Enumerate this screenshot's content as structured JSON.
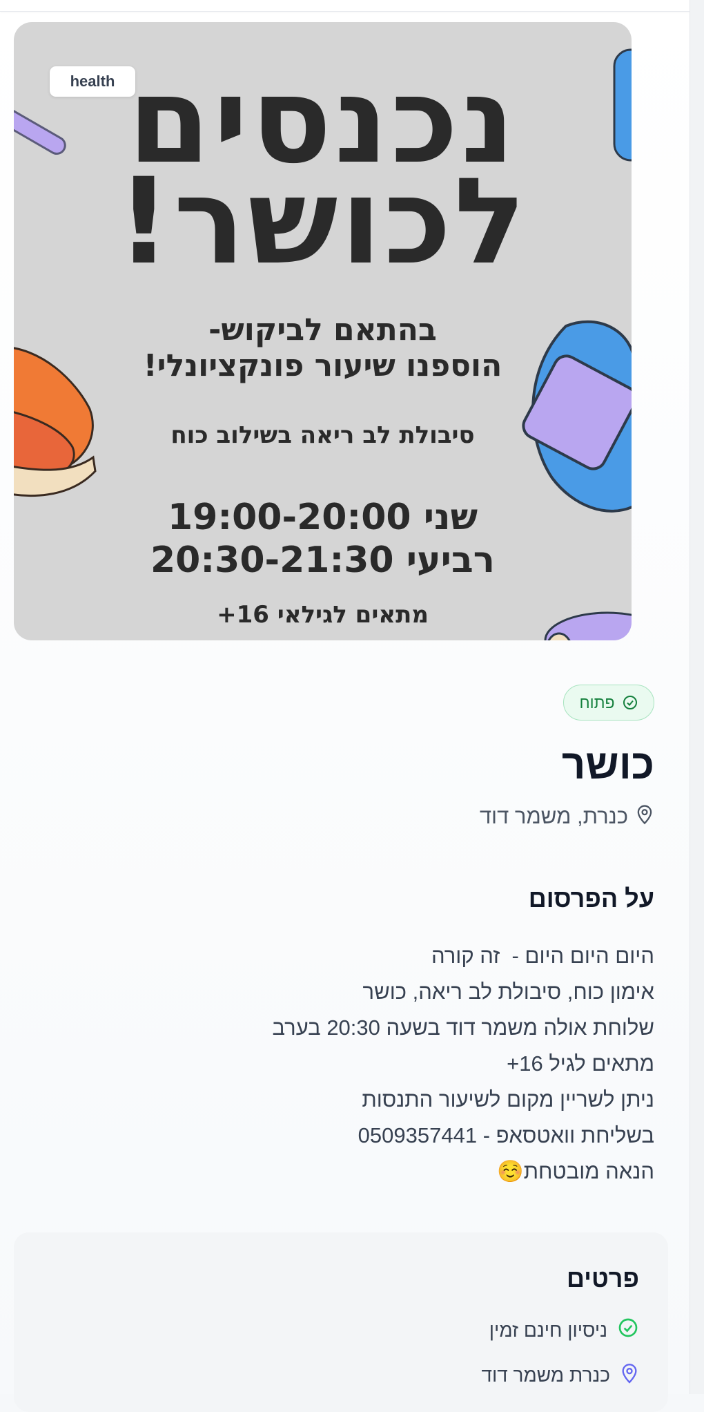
{
  "poster": {
    "category_tag": "health",
    "headline_line1": "נכנסים",
    "headline_line2": "לכושר!",
    "sub_line1": "בהתאם לביקוש-",
    "sub_line2": "הוספנו שיעור פונקציונלי!",
    "desc": "סיבולת לב ריאה בשילוב כוח",
    "schedule_line1": "שני 19:00-20:00",
    "schedule_line2": "רביעי 20:30-21:30",
    "age": "מתאים לגילאי 16+"
  },
  "status": {
    "label": "פתוח",
    "icon": "check-circle-icon",
    "color": "#15803d"
  },
  "listing": {
    "title": "כושר",
    "location": "כנרת, משמר דוד",
    "location_icon": "map-pin-icon"
  },
  "about": {
    "heading": "על הפרסום",
    "lines": [
      "היום היום היום -  זה קורה",
      "אימון כוח, סיבולת לב ריאה, כושר",
      "שלוחת אולה משמר דוד בשעה 20:30 בערב",
      "מתאים לגיל 16+",
      "ניתן לשריין מקום לשיעור התנסות",
      "בשליחת וואטסאפ - 0509357441",
      "הנאה מובטחת☺️"
    ]
  },
  "details": {
    "heading": "פרטים",
    "items": [
      {
        "icon": "check-circle-icon",
        "text": "ניסיון חינם זמין",
        "color": "#22c55e"
      },
      {
        "icon": "map-pin-icon",
        "text": "כנרת משמר דוד",
        "color": "#6366f1"
      }
    ]
  }
}
